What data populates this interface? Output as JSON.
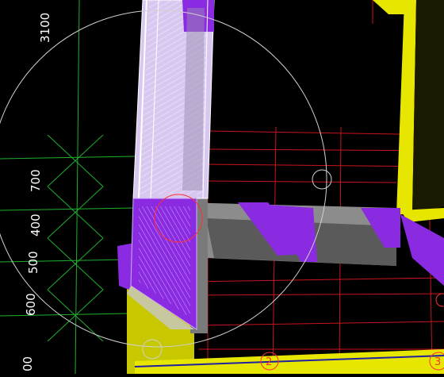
{
  "viewport": {
    "background": "#000000",
    "grid_colors": {
      "construction_lines": "#c8141e",
      "auxiliary_lines": "#1fae2e",
      "snap_circle": "#d0d0d0"
    },
    "element_colors": {
      "concrete_slab": "#e6e600",
      "selected_member": "#8a2be2",
      "beam_gray": "#8c8c8c"
    }
  },
  "dimensions": [
    {
      "value": "3100"
    },
    {
      "value": "700"
    },
    {
      "value": "400"
    },
    {
      "value": "500"
    },
    {
      "value": "600"
    },
    {
      "value": "00"
    }
  ],
  "grid_axes": [
    {
      "label": "2"
    },
    {
      "label": "3"
    }
  ]
}
